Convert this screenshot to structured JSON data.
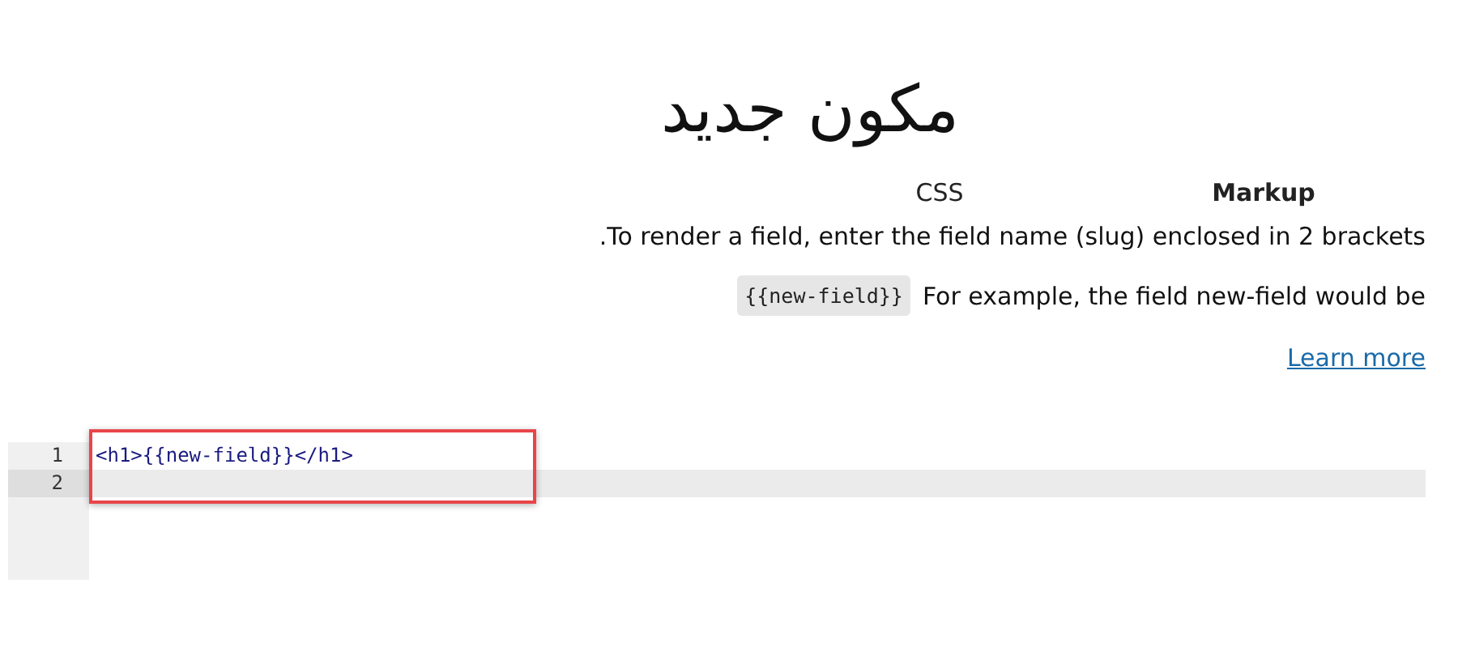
{
  "title": "مكون جديد",
  "tabs": [
    {
      "label": "CSS",
      "selected": false
    },
    {
      "label": "Markup",
      "selected": true
    }
  ],
  "help": {
    "intro": ".To render a field, enter the field name (slug) enclosed in 2 brackets",
    "example_text": "For example, the field new-field would be",
    "example_code": "{{new-field}}",
    "link": "Learn more"
  },
  "editor": {
    "lines": [
      {
        "number": "1",
        "code": "<h1>{{new-field}}</h1>",
        "active": false
      },
      {
        "number": "2",
        "active": true
      }
    ],
    "highlight_box": true
  }
}
